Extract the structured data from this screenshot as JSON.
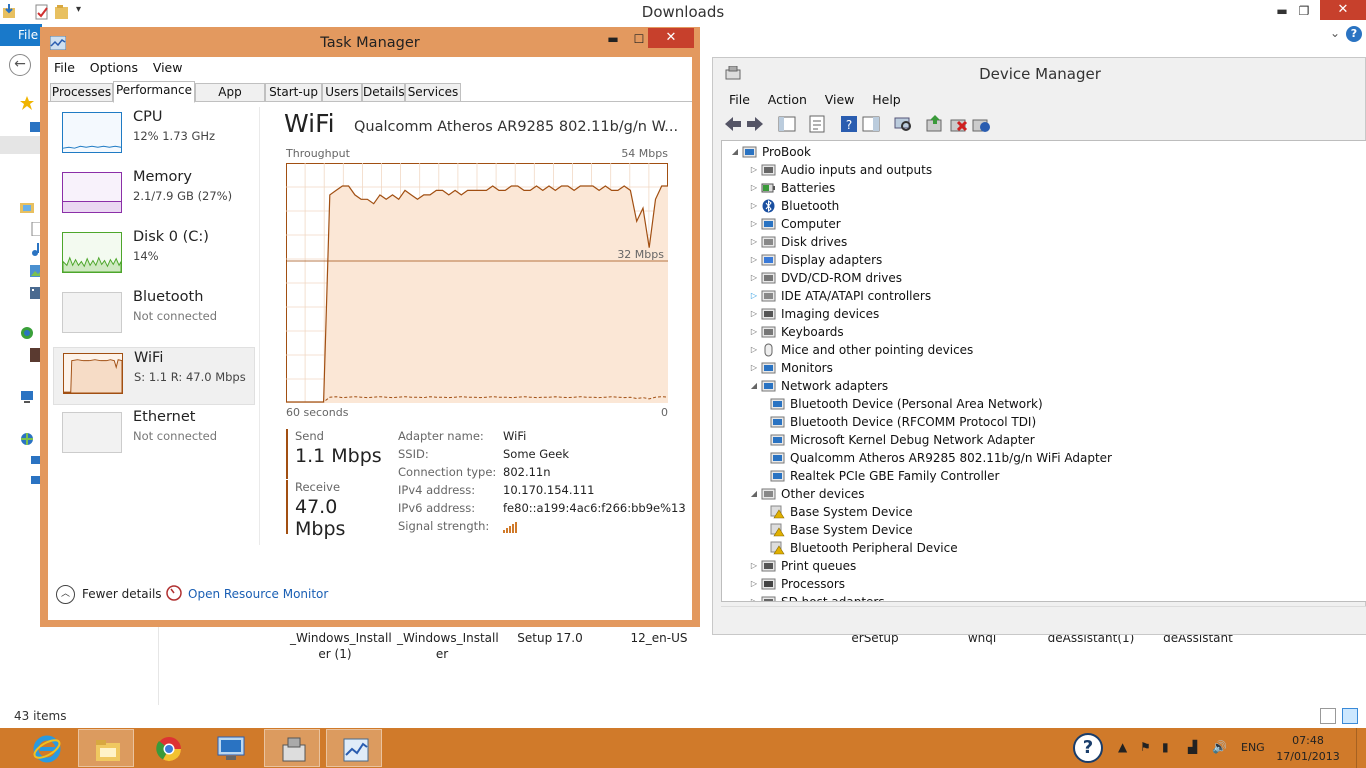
{
  "explorer": {
    "title": "Downloads",
    "file_tab": "File",
    "status_count": "43 items",
    "file_labels": [
      {
        "line1": "_Windows_Install",
        "line2": "er (1)"
      },
      {
        "line1": "_Windows_Install",
        "line2": "er"
      },
      {
        "line1": "Setup 17.0",
        "line2": ""
      },
      {
        "line1": "12_en-US",
        "line2": ""
      },
      {
        "line1": "erSetup",
        "line2": ""
      },
      {
        "line1": "whql",
        "line2": ""
      },
      {
        "line1": "deAssistant(1)",
        "line2": ""
      },
      {
        "line1": "deAssistant",
        "line2": ""
      }
    ]
  },
  "device_manager": {
    "title": "Device Manager",
    "menu": [
      "File",
      "Action",
      "View",
      "Help"
    ],
    "tree": [
      {
        "label": "ProBook",
        "level": 0,
        "expander": "expanded",
        "icon": "computer-icon"
      },
      {
        "label": "Audio inputs and outputs",
        "level": 1,
        "expander": "collapsed",
        "icon": "speaker-icon"
      },
      {
        "label": "Batteries",
        "level": 1,
        "expander": "collapsed",
        "icon": "battery-icon"
      },
      {
        "label": "Bluetooth",
        "level": 1,
        "expander": "collapsed",
        "icon": "bluetooth-icon"
      },
      {
        "label": "Computer",
        "level": 1,
        "expander": "collapsed",
        "icon": "computer-icon"
      },
      {
        "label": "Disk drives",
        "level": 1,
        "expander": "collapsed",
        "icon": "disk-icon"
      },
      {
        "label": "Display adapters",
        "level": 1,
        "expander": "collapsed",
        "icon": "display-icon"
      },
      {
        "label": "DVD/CD-ROM drives",
        "level": 1,
        "expander": "collapsed",
        "icon": "dvd-icon"
      },
      {
        "label": "IDE ATA/ATAPI controllers",
        "level": 1,
        "expander": "collapsed-hover",
        "icon": "ide-icon"
      },
      {
        "label": "Imaging devices",
        "level": 1,
        "expander": "collapsed",
        "icon": "camera-icon"
      },
      {
        "label": "Keyboards",
        "level": 1,
        "expander": "collapsed",
        "icon": "keyboard-icon"
      },
      {
        "label": "Mice and other pointing devices",
        "level": 1,
        "expander": "collapsed",
        "icon": "mouse-icon"
      },
      {
        "label": "Monitors",
        "level": 1,
        "expander": "collapsed",
        "icon": "monitor-icon"
      },
      {
        "label": "Network adapters",
        "level": 1,
        "expander": "expanded",
        "icon": "network-icon"
      },
      {
        "label": "Bluetooth Device (Personal Area Network)",
        "level": 2,
        "expander": "none",
        "icon": "network-icon"
      },
      {
        "label": "Bluetooth Device (RFCOMM Protocol TDI)",
        "level": 2,
        "expander": "none",
        "icon": "network-icon"
      },
      {
        "label": "Microsoft Kernel Debug Network Adapter",
        "level": 2,
        "expander": "none",
        "icon": "network-icon"
      },
      {
        "label": "Qualcomm Atheros AR9285 802.11b/g/n WiFi Adapter",
        "level": 2,
        "expander": "none",
        "icon": "network-icon"
      },
      {
        "label": "Realtek PCIe GBE Family Controller",
        "level": 2,
        "expander": "none",
        "icon": "network-icon"
      },
      {
        "label": "Other devices",
        "level": 1,
        "expander": "expanded",
        "icon": "unknown-device-icon"
      },
      {
        "label": "Base System Device",
        "level": 2,
        "expander": "none",
        "icon": "warning-device-icon"
      },
      {
        "label": "Base System Device",
        "level": 2,
        "expander": "none",
        "icon": "warning-device-icon"
      },
      {
        "label": "Bluetooth Peripheral Device",
        "level": 2,
        "expander": "none",
        "icon": "warning-device-icon"
      },
      {
        "label": "Print queues",
        "level": 1,
        "expander": "collapsed",
        "icon": "printer-icon"
      },
      {
        "label": "Processors",
        "level": 1,
        "expander": "collapsed",
        "icon": "processor-icon"
      },
      {
        "label": "SD host adapters",
        "level": 1,
        "expander": "collapsed",
        "icon": "sd-icon"
      }
    ]
  },
  "task_manager": {
    "title": "Task Manager",
    "menu": [
      "File",
      "Options",
      "View"
    ],
    "tabs": [
      "Processes",
      "Performance",
      "App history",
      "Start-up",
      "Users",
      "Details",
      "Services"
    ],
    "active_tab": "Performance",
    "resources": [
      {
        "name": "CPU",
        "sub": "12% 1.73 GHz",
        "color": "#1f7bc4"
      },
      {
        "name": "Memory",
        "sub": "2.1/7.9 GB (27%)",
        "color": "#8b2fa8"
      },
      {
        "name": "Disk 0 (C:)",
        "sub": "14%",
        "color": "#4da62b"
      },
      {
        "name": "Bluetooth",
        "sub": "Not connected",
        "color": "#a14f12"
      },
      {
        "name": "WiFi",
        "sub": "S: 1.1 R: 47.0 Mbps",
        "color": "#a14f12"
      },
      {
        "name": "Ethernet",
        "sub": "Not connected",
        "color": "#a14f12"
      }
    ],
    "detail": {
      "title": "WiFi",
      "adapter": "Qualcomm Atheros AR9285 802.11b/g/n W...",
      "throughput_label": "Throughput",
      "max_label": "54 Mbps",
      "mid_label": "32 Mbps",
      "x_left": "60 seconds",
      "x_right": "0",
      "send_label": "Send",
      "send_value": "1.1 Mbps",
      "receive_label": "Receive",
      "receive_value": "47.0 Mbps",
      "info": [
        {
          "key": "Adapter name:",
          "value": "WiFi"
        },
        {
          "key": "SSID:",
          "value": "Some Geek"
        },
        {
          "key": "Connection type:",
          "value": "802.11n"
        },
        {
          "key": "IPv4 address:",
          "value": "10.170.154.111"
        },
        {
          "key": "IPv6 address:",
          "value": "fe80::a199:4ac6:f266:bb9e%13"
        },
        {
          "key": "Signal strength:",
          "value": ""
        }
      ]
    },
    "footer": {
      "fewer_details": "Fewer details",
      "open_resource_monitor": "Open Resource Monitor"
    }
  },
  "chart_data": {
    "type": "line",
    "title": "Throughput",
    "ylim": [
      0,
      54
    ],
    "y_unit": "Mbps",
    "x_range_label": "60 seconds",
    "series": [
      {
        "name": "Receive",
        "values": [
          0,
          0,
          0,
          0,
          0,
          0,
          0,
          0,
          0,
          0,
          0,
          0,
          0,
          0,
          0,
          0,
          0,
          0,
          0,
          0,
          0,
          0,
          0,
          0,
          0,
          0,
          0,
          0,
          0,
          0,
          0,
          0,
          0,
          0,
          0,
          0,
          0,
          0,
          0,
          0,
          0,
          0,
          0,
          0,
          0,
          0,
          0,
          0,
          0,
          0,
          0,
          0,
          0,
          0,
          0,
          0,
          0,
          0,
          0,
          0,
          0,
          0
        ]
      },
      {
        "name": "Send",
        "values": [
          0,
          0,
          0,
          0,
          0,
          0,
          0,
          0,
          0,
          0,
          0,
          0,
          0,
          0,
          0,
          0,
          0,
          0,
          0,
          0,
          0,
          0,
          0,
          0,
          0,
          0,
          0,
          0,
          0,
          0,
          0,
          0,
          0,
          0,
          0,
          0,
          0,
          0,
          0,
          0,
          0,
          0,
          0,
          0,
          0,
          0,
          0,
          0,
          0,
          0,
          0,
          0,
          0,
          0,
          0,
          0,
          0,
          0,
          0,
          0,
          0,
          0
        ]
      }
    ],
    "receive_values": [
      0,
      0,
      0,
      0,
      0,
      0,
      0,
      47,
      48,
      49,
      49,
      47,
      46,
      46,
      45,
      47,
      46,
      47,
      46,
      48,
      47,
      46,
      47,
      47,
      48,
      48,
      47,
      48,
      47,
      48,
      48,
      48,
      48,
      49,
      48,
      48,
      49,
      49,
      48,
      48,
      49,
      48,
      49,
      48,
      49,
      49,
      48,
      49,
      49,
      49,
      48,
      49,
      48,
      48,
      49,
      48,
      41,
      44,
      35,
      46,
      49,
      49
    ],
    "send_values": [
      0,
      0,
      0,
      0,
      0,
      0,
      0,
      1.1,
      1.2,
      1.0,
      1.1,
      1.2,
      1.1,
      1.0,
      1.1,
      1.2,
      1.1,
      1.0,
      1.1,
      1.2,
      1.1,
      1.1,
      1.0,
      1.2,
      1.1,
      1.1,
      1.0,
      1.1,
      1.2,
      1.1,
      1.1,
      1.0,
      1.1,
      1.2,
      1.1,
      1.1,
      1.0,
      1.1,
      1.2,
      1.1,
      1.0,
      1.1,
      1.1,
      1.2,
      1.1,
      1.0,
      1.1,
      1.2,
      1.1,
      1.1,
      1.0,
      1.1,
      1.2,
      1.1,
      1.0,
      1.1,
      0.8,
      1.0,
      0.7,
      1.1,
      1.2,
      1.1
    ],
    "scale_line": 32,
    "grid": true
  },
  "taskbar": {
    "language": "ENG",
    "time": "07:48",
    "date": "17/01/2013",
    "items": [
      "ie-icon",
      "file-explorer-icon",
      "chrome-icon",
      "remote-desktop-icon",
      "device-manager-icon",
      "task-manager-icon"
    ]
  }
}
